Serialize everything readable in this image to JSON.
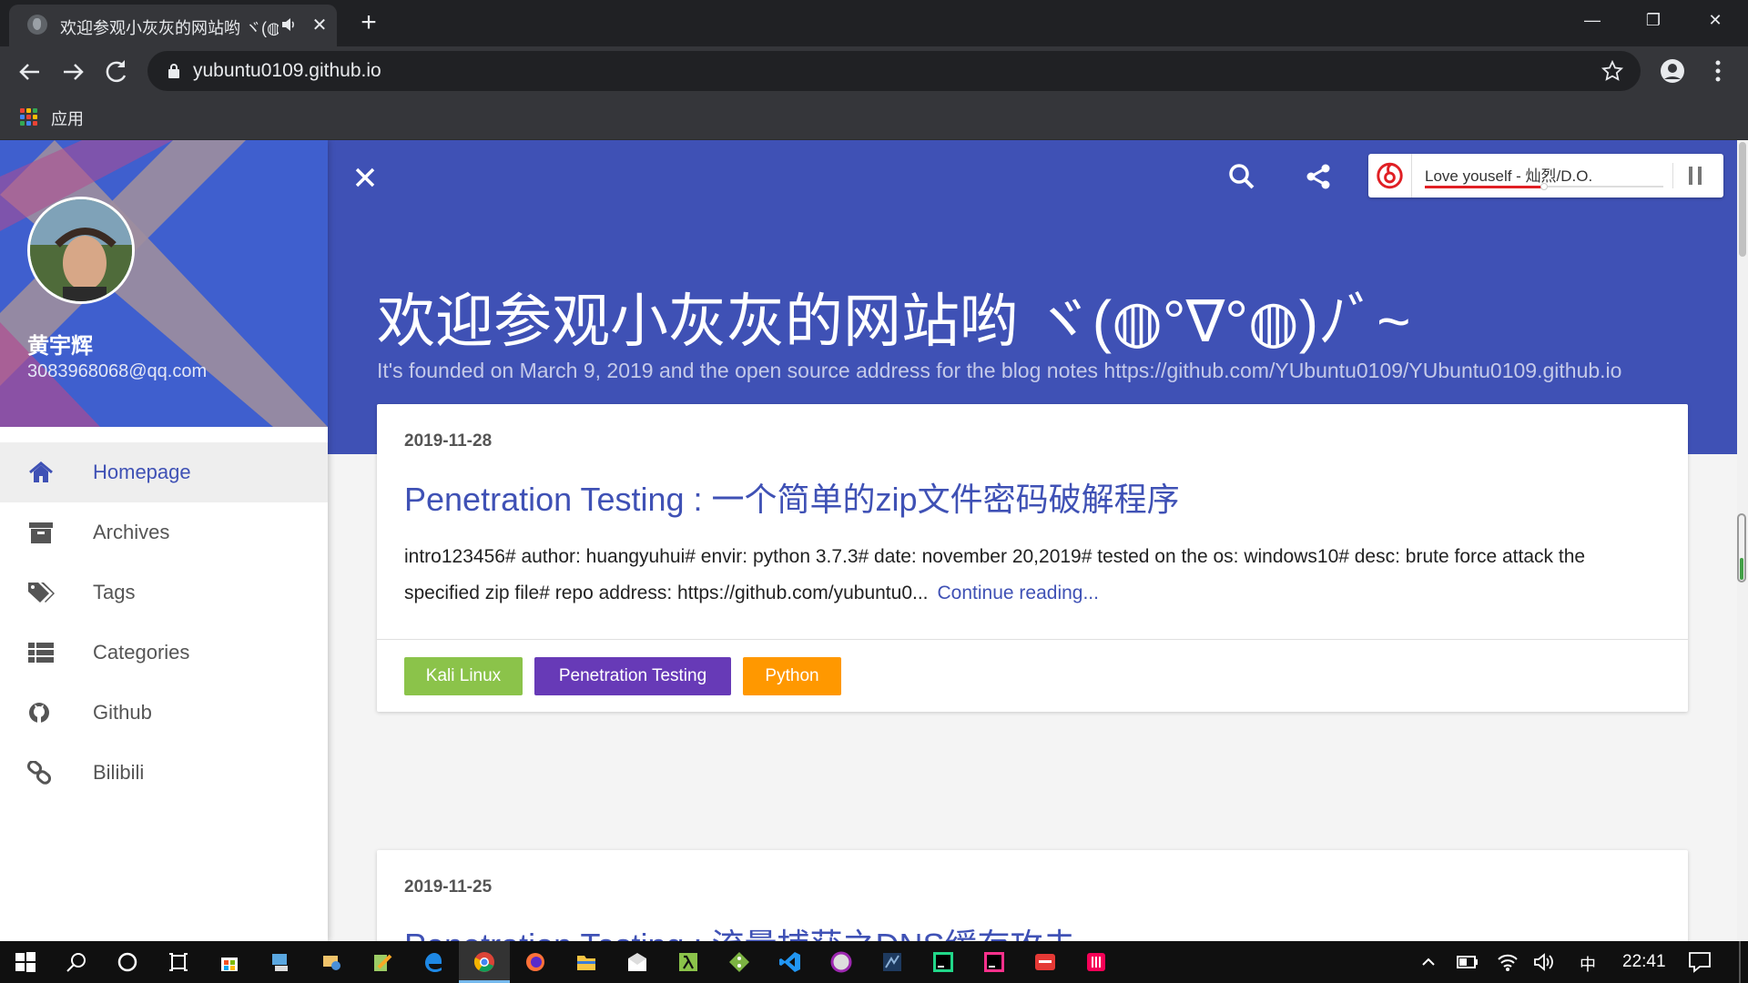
{
  "browser": {
    "tab": {
      "title": "欢迎参观小灰灰的网站哟 ヾ(◍°∇°◍)ﾉﾞ~",
      "audio_icon": "speaker-icon",
      "close_label": "✕"
    },
    "new_tab_label": "+",
    "window_controls": {
      "minimize": "—",
      "restore": "❐",
      "close": "✕"
    },
    "url": "yubuntu0109.github.io",
    "bookmarks": {
      "apps_label": "应用"
    }
  },
  "sidebar": {
    "user_name": "黄宇辉",
    "user_email": "3083968068@qq.com",
    "items": [
      {
        "label": "Homepage",
        "icon": "home-icon",
        "active": true
      },
      {
        "label": "Archives",
        "icon": "archive-icon",
        "active": false
      },
      {
        "label": "Tags",
        "icon": "tags-icon",
        "active": false
      },
      {
        "label": "Categories",
        "icon": "list-icon",
        "active": false
      },
      {
        "label": "Github",
        "icon": "github-icon",
        "active": false
      },
      {
        "label": "Bilibili",
        "icon": "link-icon",
        "active": false
      }
    ]
  },
  "header": {
    "site_title": "欢迎参观小灰灰的网站哟 ヾ(◍°∇°◍)ﾉﾞ~",
    "site_subtitle": "It's founded on March 9, 2019 and the open source address for the blog notes https://github.com/YUbuntu0109/YUbuntu0109.github.io"
  },
  "player": {
    "track_title": "Love youself - 灿烈/D.O.",
    "progress": 0.5
  },
  "posts": [
    {
      "date": "2019-11-28",
      "title": "Penetration Testing : 一个简单的zip文件密码破解程序",
      "excerpt": "intro123456# author: huangyuhui# envir: python 3.7.3# date: november 20,2019# tested on the os: windows10# desc: brute force attack the specified zip file# repo address: https://github.com/yubuntu0...",
      "more_label": "Continue reading...",
      "tags": [
        {
          "label": "Kali Linux",
          "color": "#8bc34a"
        },
        {
          "label": "Penetration Testing",
          "color": "#673ab7"
        },
        {
          "label": "Python",
          "color": "#ff9800"
        }
      ]
    },
    {
      "date": "2019-11-25",
      "title": "Penetration Testing : 流量捕获之DNS缓存攻击"
    }
  ],
  "taskbar": {
    "ime": "中",
    "time": "22:41"
  },
  "colors": {
    "primary": "#3f51b5",
    "sidebar_header": "#3f5fce",
    "chrome_dark": "#202124",
    "chrome_toolbar": "#35363a",
    "player_accent": "#e01f24"
  }
}
